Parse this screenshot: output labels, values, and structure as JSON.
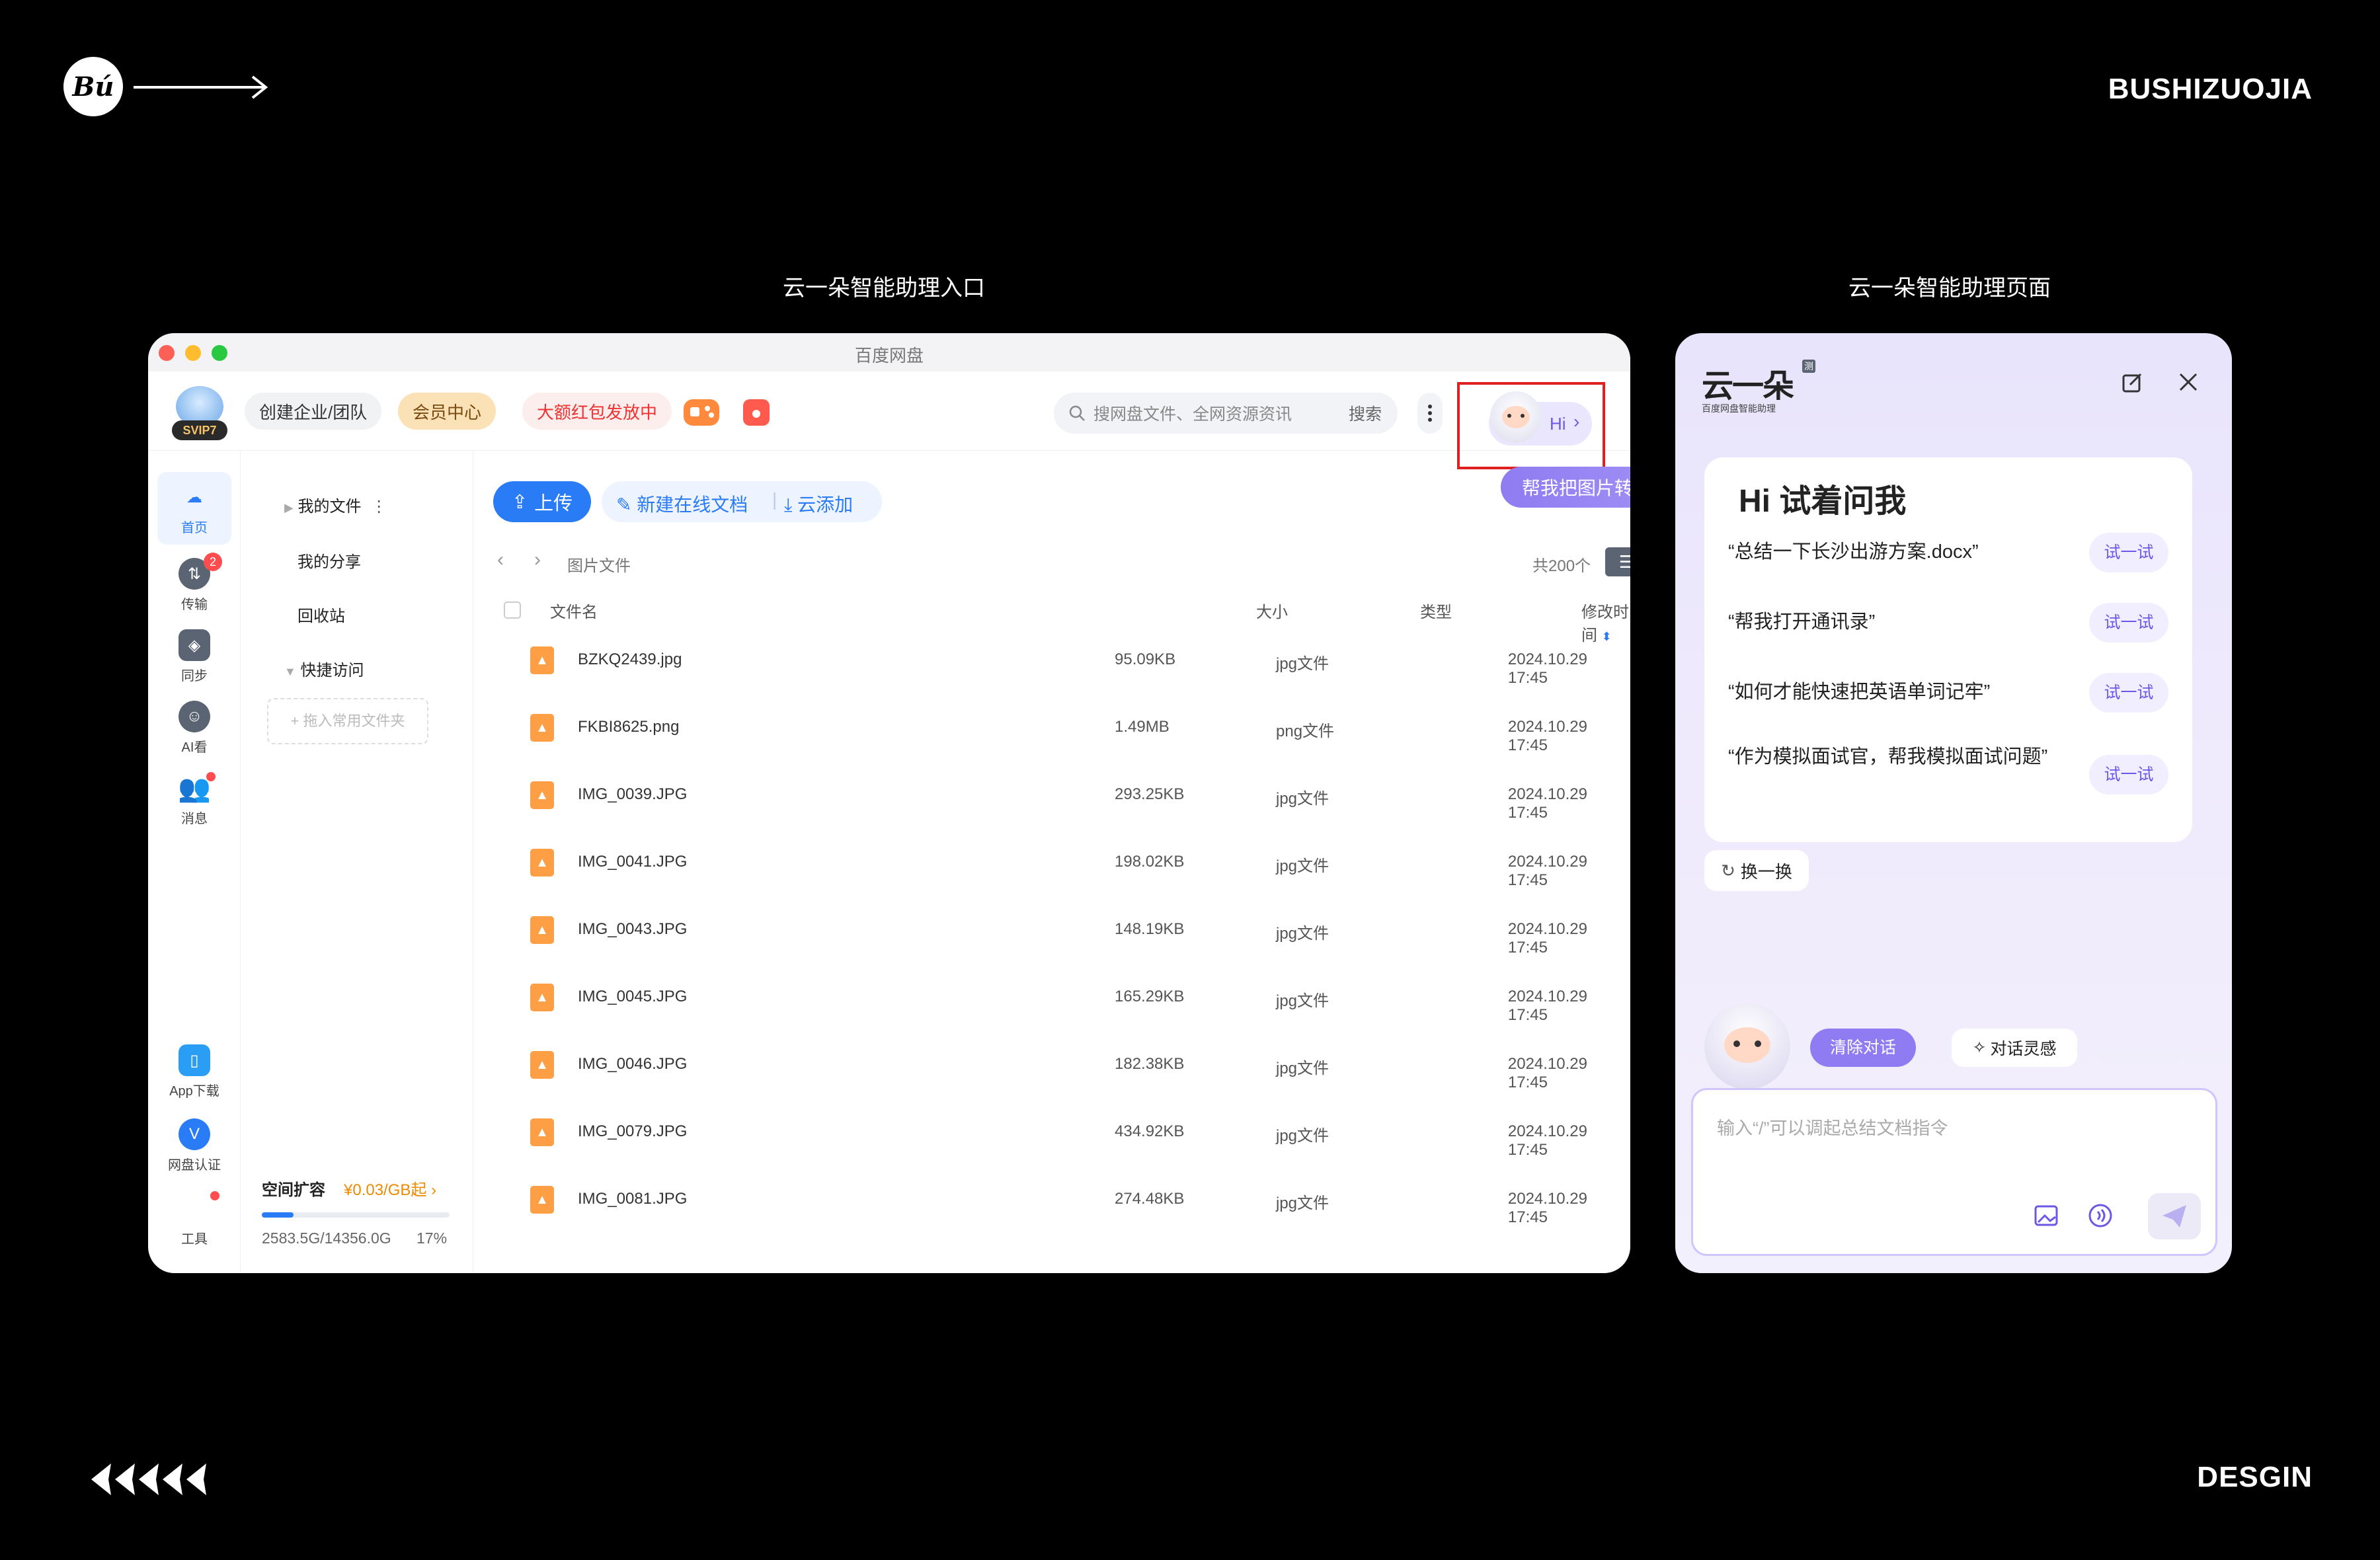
{
  "page": {
    "brand_logo": "Bú",
    "brand_name": "BUSHIZUOJIA",
    "footer_label": "DESGIN",
    "caption_left": "云一朵智能助理入口",
    "caption_right": "云一朵智能助理页面"
  },
  "app": {
    "window_title": "百度网盘",
    "avatar_badge": "SVIP7",
    "top_buttons": [
      "创建企业/团队",
      "会员中心",
      "大额红包发放中"
    ],
    "search_placeholder": "搜网盘文件、全网资源资讯",
    "search_button": "搜索",
    "hi_label": "Hi",
    "suggestion_chip": "帮我把图片转成Word",
    "left_nav": [
      {
        "label": "首页",
        "icon": "cloud-home-icon",
        "active": true
      },
      {
        "label": "传输",
        "icon": "transfer-icon",
        "badge": "2"
      },
      {
        "label": "同步",
        "icon": "sync-icon"
      },
      {
        "label": "AI看",
        "icon": "ai-look-icon"
      },
      {
        "label": "消息",
        "icon": "message-icon"
      }
    ],
    "bottom_nav": [
      {
        "label": "App下载",
        "icon": "phone-icon"
      },
      {
        "label": "网盘认证",
        "icon": "verify-icon"
      },
      {
        "label": "工具",
        "icon": "tools-icon"
      }
    ],
    "tree": {
      "my_files": "我的文件",
      "my_share": "我的分享",
      "recycle": "回收站",
      "quick_access": "快捷访问",
      "drop_hint": "+ 拖入常用文件夹"
    },
    "storage": {
      "title": "空间扩容",
      "price": "¥0.03/GB起",
      "usage": "2583.5G/14356.0G",
      "percent_label": "17%",
      "fraction": 0.17
    },
    "toolbar": {
      "upload": "上传",
      "new_doc": "新建在线文档",
      "cloud_add": "云添加"
    },
    "breadcrumb": "图片文件",
    "total_count": "共200个",
    "columns": {
      "name": "文件名",
      "size": "大小",
      "type": "类型",
      "modified": "修改时间"
    },
    "files": [
      {
        "name": "BZKQ2439.jpg",
        "size": "95.09KB",
        "type": "jpg文件",
        "modified": "2024.10.29 17:45"
      },
      {
        "name": "FKBI8625.png",
        "size": "1.49MB",
        "type": "png文件",
        "modified": "2024.10.29 17:45"
      },
      {
        "name": "IMG_0039.JPG",
        "size": "293.25KB",
        "type": "jpg文件",
        "modified": "2024.10.29 17:45"
      },
      {
        "name": "IMG_0041.JPG",
        "size": "198.02KB",
        "type": "jpg文件",
        "modified": "2024.10.29 17:45"
      },
      {
        "name": "IMG_0043.JPG",
        "size": "148.19KB",
        "type": "jpg文件",
        "modified": "2024.10.29 17:45"
      },
      {
        "name": "IMG_0045.JPG",
        "size": "165.29KB",
        "type": "jpg文件",
        "modified": "2024.10.29 17:45"
      },
      {
        "name": "IMG_0046.JPG",
        "size": "182.38KB",
        "type": "jpg文件",
        "modified": "2024.10.29 17:45"
      },
      {
        "name": "IMG_0079.JPG",
        "size": "434.92KB",
        "type": "jpg文件",
        "modified": "2024.10.29 17:45"
      },
      {
        "name": "IMG_0081.JPG",
        "size": "274.48KB",
        "type": "jpg文件",
        "modified": "2024.10.29 17:45"
      }
    ]
  },
  "assistant": {
    "logo_text": "云一朵",
    "logo_badge": "测",
    "logo_subtitle": "百度网盘智能助理",
    "heading": "Hi 试着问我",
    "prompts": [
      {
        "text": "“总结一下长沙出游方案.docx”",
        "action": "试一试"
      },
      {
        "text": "“帮我打开通讯录”",
        "action": "试一试"
      },
      {
        "text": "“如何才能快速把英语单词记牢”",
        "action": "试一试"
      },
      {
        "text": "“作为模拟面试官，帮我模拟面试问题”",
        "action": "试一试"
      }
    ],
    "refresh": "换一换",
    "clear_chat": "清除对话",
    "inspiration": "对话灵感",
    "input_placeholder": "输入“/”可以调起总结文档指令",
    "colors": {
      "accent": "#6b57e8",
      "highlight_box": "#e02020",
      "upload_blue": "#2a7cf6"
    }
  }
}
